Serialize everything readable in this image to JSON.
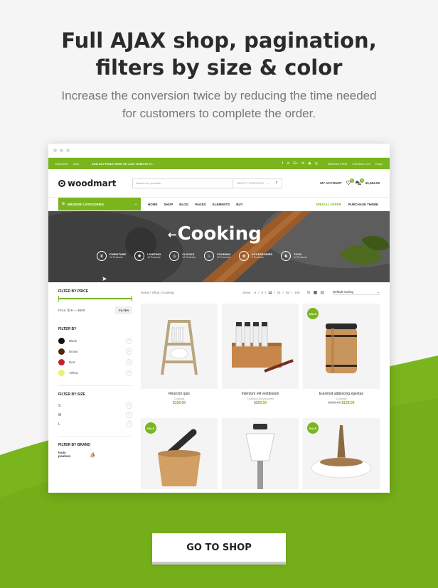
{
  "hero": {
    "title_line1": "Full AJAX shop, pagination,",
    "title_line2": "filters by size & color",
    "subtitle_line1": "Increase the conversion twice by reducing the time needed",
    "subtitle_line2": "for customers to complete the order."
  },
  "topbar": {
    "language": "ENGLISH",
    "currency": "USD",
    "promo": "ADD ANYTHING HERE OR JUST REMOVE IT...",
    "links": [
      "NEWSLETTER",
      "CONTACT US",
      "FAQs"
    ]
  },
  "header": {
    "logo": "woodmart",
    "search_placeholder": "Search for products",
    "category_select": "SELECT CATEGORY",
    "account": "MY ACCOUNT",
    "wishlist_count": "0",
    "cart_count": "2",
    "cart_total": "$1,594.00"
  },
  "nav": {
    "browse": "BROWSE CATEGORIES",
    "items": [
      "HOME",
      "SHOP",
      "BLOG",
      "PAGES",
      "ELEMENTS",
      "BUY"
    ],
    "special": "SPECIAL OFFER",
    "purchase": "PURCHASE THEME"
  },
  "banner": {
    "title": "Cooking",
    "categories": [
      {
        "name": "FURNITURE",
        "count": "10 Products"
      },
      {
        "name": "LIGHTING",
        "count": "16 Products"
      },
      {
        "name": "CLOCKS",
        "count": "12 Products"
      },
      {
        "name": "COOKING",
        "count": "12 Products"
      },
      {
        "name": "ACCESSORIES",
        "count": "6 Products"
      },
      {
        "name": "TOYS",
        "count": "12 Products"
      }
    ]
  },
  "filters": {
    "price_title": "FILTER BY PRICE",
    "price_range": "Price: $29 — $589",
    "filter_button": "FILTER",
    "color_title": "FILTER BY",
    "colors": [
      {
        "name": "Black",
        "count": "2",
        "hex": "#111111"
      },
      {
        "name": "Brown",
        "count": "3",
        "hex": "#4a2a12"
      },
      {
        "name": "Red",
        "count": "3",
        "hex": "#c9202d"
      },
      {
        "name": "Yellow",
        "count": "2",
        "hex": "#eef06a"
      }
    ],
    "size_title": "FILTER BY SIZE",
    "sizes": [
      {
        "name": "S",
        "count": "1"
      },
      {
        "name": "M",
        "count": "1"
      },
      {
        "name": "L",
        "count": "1"
      }
    ],
    "brand_title": "FILTER BY BRAND",
    "brands": [
      "louis poulsen"
    ]
  },
  "shop": {
    "breadcrumb": "Home / Shop / Cooking",
    "show_label": "Show :",
    "show_options": [
      "6",
      "9",
      "12",
      "24",
      "36",
      "100"
    ],
    "show_selected": "12",
    "sort": "Default sorting"
  },
  "products": [
    {
      "name": "Rirurctor quis",
      "category": "Cooking",
      "price": "$159.00",
      "old_price": "",
      "sale": false
    },
    {
      "name": "Interdum elit vestibulum",
      "category": "Cooking, Accessories",
      "price": "$259.00",
      "old_price": "",
      "sale": false
    },
    {
      "name": "Euismod adipiscing egestas",
      "category": "Cooking",
      "price": "$139.00",
      "old_price": "$259.00",
      "sale": true
    },
    {
      "name": "",
      "category": "",
      "price": "",
      "old_price": "",
      "sale": true
    },
    {
      "name": "",
      "category": "",
      "price": "",
      "old_price": "",
      "sale": false
    },
    {
      "name": "",
      "category": "",
      "price": "",
      "old_price": "",
      "sale": true
    }
  ],
  "sale_label": "SALE",
  "cta": "GO TO SHOP",
  "colors": {
    "accent": "#7ab51d",
    "background": "#f5f5f5"
  }
}
